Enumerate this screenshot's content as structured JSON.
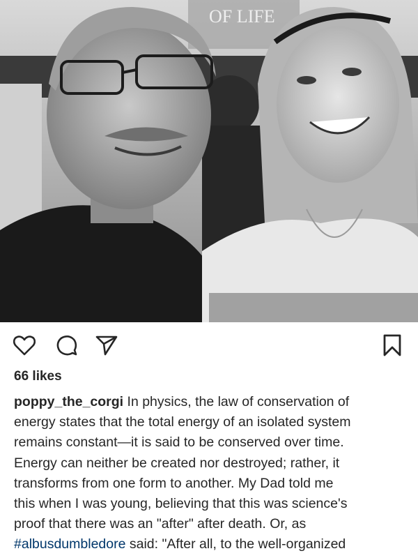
{
  "post": {
    "photo": {
      "background_banner_text": "OF LIFE"
    },
    "actions": {
      "like_icon": "heart-icon",
      "comment_icon": "comment-icon",
      "share_icon": "paper-plane-icon",
      "save_icon": "bookmark-icon"
    },
    "likes_label": "66 likes",
    "caption": {
      "username": "poppy_the_corgi",
      "lines": [
        " In physics, the law of conservation of",
        "energy states that the total energy of an isolated system",
        "remains constant—it is said to be conserved over time.",
        "Energy can neither be created nor destroyed; rather, it",
        "transforms from one form to another.  My Dad told me",
        "this when I was young, believing that this was science's",
        "proof that there was an \"after\" after death.  Or, as"
      ],
      "hashtag": "#albusdumbledore",
      "last_line_rest": " said: \"After all, to the well-organized"
    }
  },
  "colors": {
    "text": "#262626",
    "hashtag": "#00376b",
    "background": "#ffffff"
  }
}
